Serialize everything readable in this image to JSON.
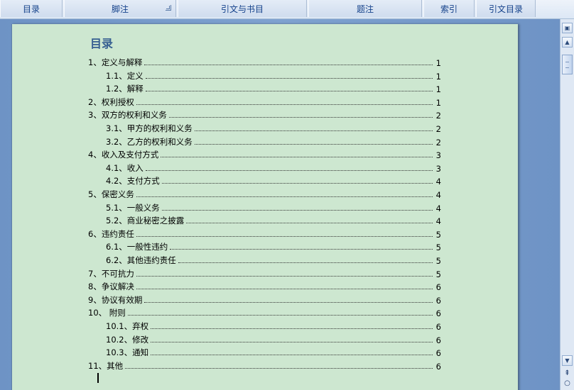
{
  "ribbon": {
    "groups": [
      {
        "label": "目录",
        "launcher": false
      },
      {
        "label": "脚注",
        "launcher": true
      },
      {
        "label": "引文与书目",
        "launcher": false
      },
      {
        "label": "题注",
        "launcher": false
      },
      {
        "label": "索引",
        "launcher": false
      },
      {
        "label": "引文目录",
        "launcher": false
      }
    ]
  },
  "document": {
    "toc_title": "目录",
    "entries": [
      {
        "text": "1、定义与解释",
        "page": "1",
        "level": 1
      },
      {
        "text": "1.1、定义",
        "page": "1",
        "level": 2
      },
      {
        "text": "1.2、解释",
        "page": "1",
        "level": 2
      },
      {
        "text": "2、权利授权",
        "page": "1",
        "level": 1
      },
      {
        "text": "3、双方的权利和义务",
        "page": "2",
        "level": 1
      },
      {
        "text": "3.1、甲方的权利和义务",
        "page": "2",
        "level": 2
      },
      {
        "text": "3.2、乙方的权利和义务",
        "page": "2",
        "level": 2
      },
      {
        "text": "4、收入及支付方式",
        "page": "3",
        "level": 1
      },
      {
        "text": "4.1、收入",
        "page": "3",
        "level": 2
      },
      {
        "text": "4.2、支付方式",
        "page": "4",
        "level": 2
      },
      {
        "text": "5、保密义务",
        "page": "4",
        "level": 1
      },
      {
        "text": "5.1、一般义务",
        "page": "4",
        "level": 2
      },
      {
        "text": "5.2、商业秘密之披露",
        "page": "4",
        "level": 2
      },
      {
        "text": "6、违约责任",
        "page": "5",
        "level": 1
      },
      {
        "text": "6.1、一般性违约",
        "page": "5",
        "level": 2
      },
      {
        "text": "6.2、其他违约责任",
        "page": "5",
        "level": 2
      },
      {
        "text": "7、不可抗力",
        "page": "5",
        "level": 1
      },
      {
        "text": "8、争议解决",
        "page": "6",
        "level": 1
      },
      {
        "text": "9、协议有效期",
        "page": "6",
        "level": 1
      },
      {
        "text": "10、 附则",
        "page": "6",
        "level": 1
      },
      {
        "text": "10.1、弃权",
        "page": "6",
        "level": 2
      },
      {
        "text": "10.2、修改",
        "page": "6",
        "level": 2
      },
      {
        "text": "10.3、通知",
        "page": "6",
        "level": 2
      },
      {
        "text": "11、其他",
        "page": "6",
        "level": 1
      }
    ]
  },
  "scrollbar": {
    "up_icon": "ruler-toggle-icon",
    "arrow_up": "scroll-up-arrow-icon",
    "arrow_down": "scroll-down-arrow-icon",
    "prev_page_icon": "previous-page-icon",
    "browse_object_icon": "select-browse-object-icon"
  },
  "colors": {
    "page_background": "#cde7d0",
    "title_color": "#365f91",
    "ribbon_text": "#15428b"
  }
}
